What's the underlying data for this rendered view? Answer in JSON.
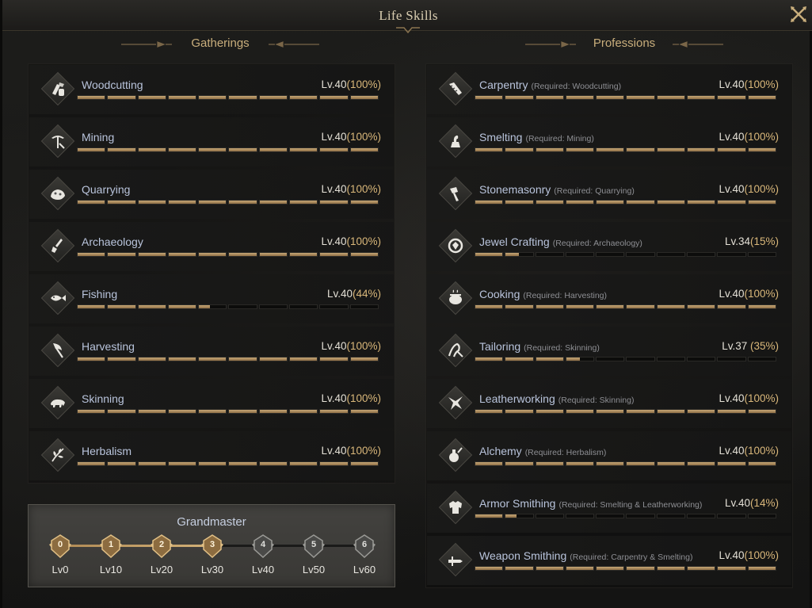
{
  "window": {
    "title": "Life Skills"
  },
  "gatherings": {
    "header": "Gatherings",
    "skills": [
      {
        "icon": "woodcutting-icon",
        "name": "Woodcutting",
        "required": "",
        "level": "Lv.40",
        "percent": "(100%)",
        "progress": 1.0
      },
      {
        "icon": "mining-icon",
        "name": "Mining",
        "required": "",
        "level": "Lv.40",
        "percent": "(100%)",
        "progress": 1.0
      },
      {
        "icon": "quarrying-icon",
        "name": "Quarrying",
        "required": "",
        "level": "Lv.40",
        "percent": "(100%)",
        "progress": 1.0
      },
      {
        "icon": "archaeology-icon",
        "name": "Archaeology",
        "required": "",
        "level": "Lv.40",
        "percent": "(100%)",
        "progress": 1.0
      },
      {
        "icon": "fishing-icon",
        "name": "Fishing",
        "required": "",
        "level": "Lv.40",
        "percent": "(44%)",
        "progress": 0.44
      },
      {
        "icon": "harvesting-icon",
        "name": "Harvesting",
        "required": "",
        "level": "Lv.40",
        "percent": "(100%)",
        "progress": 1.0
      },
      {
        "icon": "skinning-icon",
        "name": "Skinning",
        "required": "",
        "level": "Lv.40",
        "percent": "(100%)",
        "progress": 1.0
      },
      {
        "icon": "herbalism-icon",
        "name": "Herbalism",
        "required": "",
        "level": "Lv.40",
        "percent": "(100%)",
        "progress": 1.0
      }
    ]
  },
  "professions": {
    "header": "Professions",
    "skills": [
      {
        "icon": "carpentry-icon",
        "name": "Carpentry",
        "required": "(Required: Woodcutting)",
        "level": "Lv.40",
        "percent": "(100%)",
        "progress": 1.0
      },
      {
        "icon": "smelting-icon",
        "name": "Smelting",
        "required": "(Required: Mining)",
        "level": "Lv.40",
        "percent": "(100%)",
        "progress": 1.0
      },
      {
        "icon": "stonemasonry-icon",
        "name": "Stonemasonry",
        "required": "(Required: Quarrying)",
        "level": "Lv.40",
        "percent": "(100%)",
        "progress": 1.0
      },
      {
        "icon": "jewel-crafting-icon",
        "name": "Jewel Crafting",
        "required": "(Required: Archaeology)",
        "level": "Lv.34",
        "percent": "(15%)",
        "progress": 0.15
      },
      {
        "icon": "cooking-icon",
        "name": "Cooking",
        "required": "(Required: Harvesting)",
        "level": "Lv.40",
        "percent": "(100%)",
        "progress": 1.0
      },
      {
        "icon": "tailoring-icon",
        "name": "Tailoring",
        "required": "(Required: Skinning)",
        "level": "Lv.37",
        "percent": " (35%)",
        "progress": 0.35
      },
      {
        "icon": "leatherworking-icon",
        "name": "Leatherworking",
        "required": "(Required: Skinning)",
        "level": "Lv.40",
        "percent": "(100%)",
        "progress": 1.0
      },
      {
        "icon": "alchemy-icon",
        "name": "Alchemy",
        "required": "(Required: Herbalism)",
        "level": "Lv.40",
        "percent": "(100%)",
        "progress": 1.0
      },
      {
        "icon": "armor-smithing-icon",
        "name": "Armor Smithing",
        "required": "(Required: Smelting & Leatherworking)",
        "level": "Lv.40",
        "percent": "(14%)",
        "progress": 0.14
      },
      {
        "icon": "weapon-smithing-icon",
        "name": "Weapon Smithing",
        "required": "(Required: Carpentry & Smelting)",
        "level": "Lv.40",
        "percent": "(100%)",
        "progress": 1.0
      }
    ]
  },
  "grandmaster": {
    "title": "Grandmaster",
    "reached": 3,
    "nodes": [
      {
        "num": "0",
        "label": "Lv0"
      },
      {
        "num": "1",
        "label": "Lv10"
      },
      {
        "num": "2",
        "label": "Lv20"
      },
      {
        "num": "3",
        "label": "Lv30"
      },
      {
        "num": "4",
        "label": "Lv40"
      },
      {
        "num": "5",
        "label": "Lv50"
      },
      {
        "num": "6",
        "label": "Lv60"
      }
    ]
  },
  "colors": {
    "accent": "#c9ae7c",
    "bar_fill": "#b08a55",
    "name": "#b9c4dc"
  }
}
